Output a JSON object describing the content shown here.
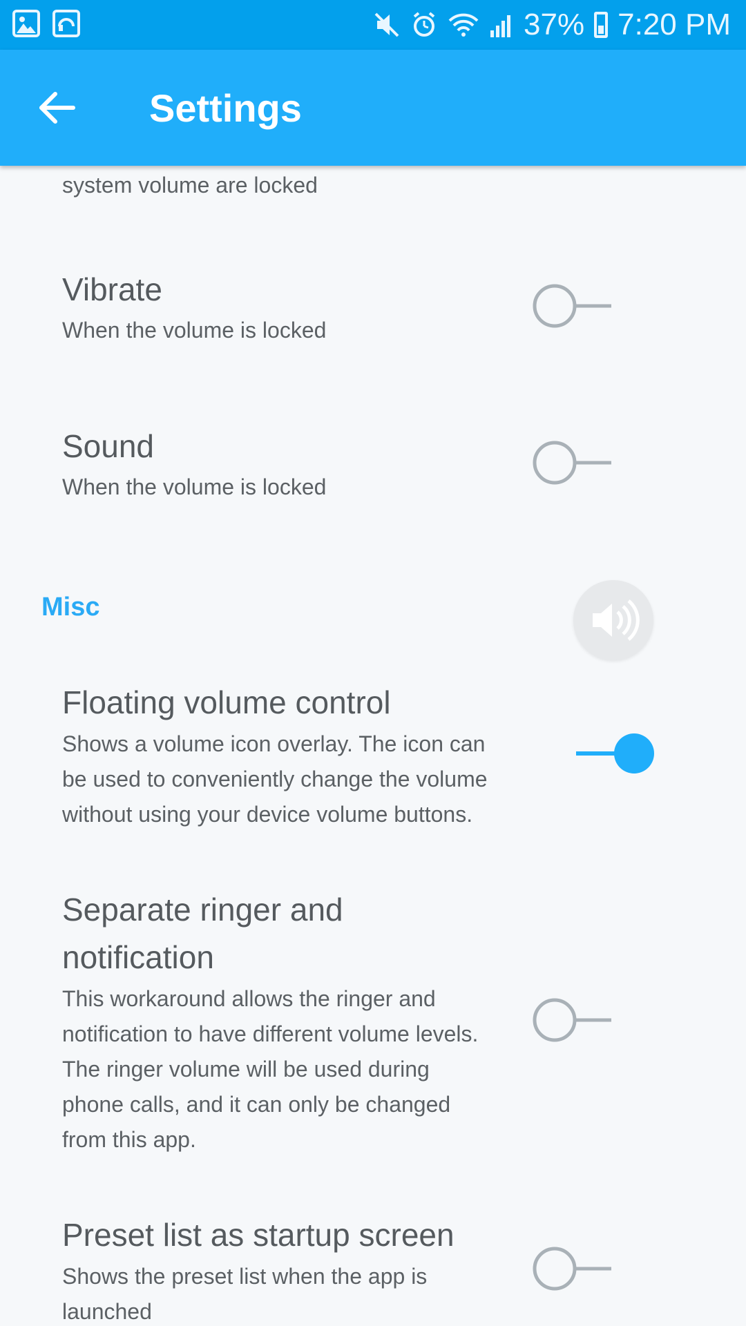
{
  "status_bar": {
    "battery_percent": "37%",
    "time": "7:20 PM",
    "left_icons": [
      "gallery-icon",
      "headset-app-icon"
    ],
    "right_icons": [
      "mute-icon",
      "alarm-icon",
      "wifi-icon",
      "signal-icon",
      "battery-icon"
    ]
  },
  "app_bar": {
    "title": "Settings",
    "back_icon": "arrow-left-icon",
    "color": "#20aefa"
  },
  "prefs": {
    "truncated_summary": "system volume are locked",
    "vibrate": {
      "title": "Vibrate",
      "summary": "When the volume is locked",
      "enabled": false
    },
    "sound": {
      "title": "Sound",
      "summary": "When the volume is locked",
      "enabled": false
    },
    "misc_header": "Misc",
    "floating": {
      "title": "Floating volume control",
      "summary_lines": [
        "Shows a volume icon overlay. The icon can",
        "be used to conveniently change the volume",
        "without using your device volume buttons."
      ],
      "enabled": true
    },
    "separate": {
      "title_lines": [
        "Separate ringer and",
        "notification"
      ],
      "summary_lines": [
        "This workaround allows the ringer and",
        "notification to have different volume levels.",
        "The ringer volume will be used during",
        "phone calls, and it can only be changed",
        "from this app."
      ],
      "enabled": false
    },
    "preset": {
      "title": "Preset list as startup screen",
      "summary_lines": [
        "Shows the preset list when the app is",
        "launched"
      ],
      "enabled": false
    }
  },
  "floating_overlay": {
    "icon": "speaker-volume-icon"
  },
  "colors": {
    "status_bar": "#03a0ec",
    "accent": "#2aaaf5",
    "switch_off": "#a9b1b7",
    "background": "#f6f8fa"
  }
}
